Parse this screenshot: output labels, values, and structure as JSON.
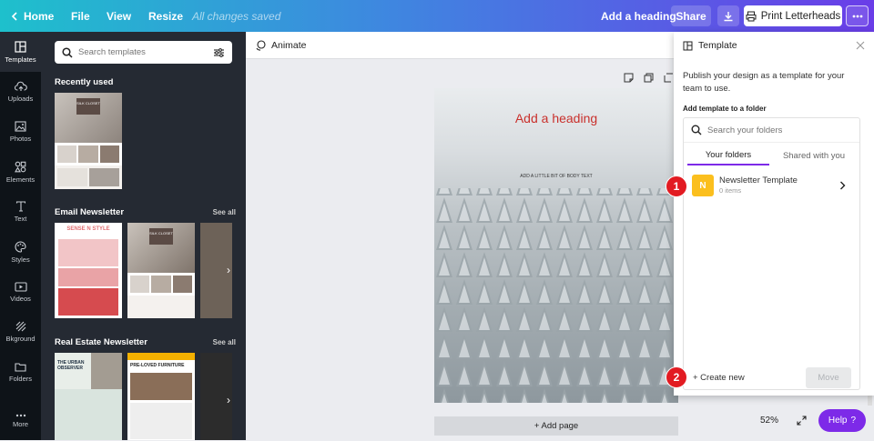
{
  "topbar": {
    "home": "Home",
    "file": "File",
    "view": "View",
    "resize": "Resize",
    "saved_status": "All changes saved",
    "design_title": "Add a heading",
    "share": "Share",
    "print": "Print Letterheads"
  },
  "rail": [
    {
      "label": "Templates",
      "icon": "templates-icon"
    },
    {
      "label": "Uploads",
      "icon": "upload-cloud-icon"
    },
    {
      "label": "Photos",
      "icon": "photo-icon"
    },
    {
      "label": "Elements",
      "icon": "shapes-icon"
    },
    {
      "label": "Text",
      "icon": "text-icon"
    },
    {
      "label": "Styles",
      "icon": "palette-icon"
    },
    {
      "label": "Videos",
      "icon": "video-icon"
    },
    {
      "label": "Bkground",
      "icon": "background-icon"
    },
    {
      "label": "Folders",
      "icon": "folder-icon"
    },
    {
      "label": "More",
      "icon": "more-dots-icon"
    }
  ],
  "panel": {
    "search_placeholder": "Search templates",
    "recently_used": "Recently used",
    "email_newsletter": "Email Newsletter",
    "real_estate": "Real Estate Newsletter",
    "see_all": "See all",
    "thumb_silk": "SILK CLOSET",
    "thumb_sense": "SENSE N STYLE",
    "thumb_urban": "THE URBAN OBSERVER",
    "thumb_preloved": "PRE-LOVED FURNITURE"
  },
  "canvas": {
    "animate": "Animate",
    "heading": "Add a heading",
    "body": "ADD A LITTLE BIT OF BODY TEXT",
    "add_page": "+ Add page",
    "zoom": "52%",
    "help": "Help",
    "help_glyph": "?"
  },
  "popup": {
    "title": "Template",
    "description": "Publish your design as a template for your team to use.",
    "subtitle": "Add template to a folder",
    "search_placeholder": "Search your folders",
    "tab_yours": "Your folders",
    "tab_shared": "Shared with you",
    "folder_badge": "N",
    "folder_name": "Newsletter Template",
    "folder_count": "0 items",
    "create_new": "+ Create new",
    "move": "Move"
  },
  "markers": [
    "1",
    "2"
  ],
  "colors": {
    "accent_purple": "#7d2ae8",
    "folder_yellow": "#fbbf1e",
    "marker_red": "#e21b22",
    "heading_red": "#c9302c"
  }
}
